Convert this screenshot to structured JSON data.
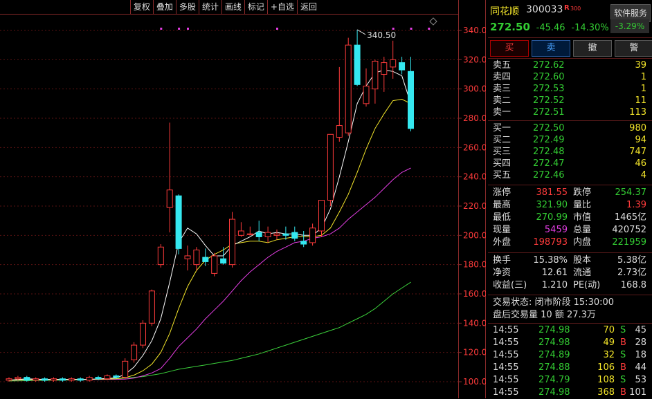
{
  "toolbar": [
    "复权",
    "叠加",
    "多股",
    "统计",
    "画线",
    "标记",
    "+自选",
    "返回"
  ],
  "stock": {
    "name": "同花顺",
    "code": "300033",
    "badge": "R",
    "badge_sub": "300",
    "service": "软件服务",
    "price": "272.50",
    "change": "-45.46",
    "change_pct": "-14.30%",
    "badge_pct": "-3.29%"
  },
  "trade_buttons": [
    "买",
    "卖",
    "撤",
    "警"
  ],
  "sell_orders": [
    {
      "label": "卖五",
      "price": "272.62",
      "vol": "39"
    },
    {
      "label": "卖四",
      "price": "272.60",
      "vol": "1"
    },
    {
      "label": "卖三",
      "price": "272.53",
      "vol": "1"
    },
    {
      "label": "卖二",
      "price": "272.52",
      "vol": "11"
    },
    {
      "label": "卖一",
      "price": "272.51",
      "vol": "113"
    }
  ],
  "buy_orders": [
    {
      "label": "买一",
      "price": "272.50",
      "vol": "980"
    },
    {
      "label": "买二",
      "price": "272.49",
      "vol": "94"
    },
    {
      "label": "买三",
      "price": "272.48",
      "vol": "747"
    },
    {
      "label": "买四",
      "price": "272.47",
      "vol": "46"
    },
    {
      "label": "买五",
      "price": "272.46",
      "vol": "4"
    }
  ],
  "stats": [
    {
      "l1": "涨停",
      "v1": "381.55",
      "c1": "red",
      "l2": "跌停",
      "v2": "254.37",
      "c2": "green"
    },
    {
      "l1": "最高",
      "v1": "321.90",
      "c1": "green",
      "l2": "量比",
      "v2": "1.39",
      "c2": "red"
    },
    {
      "l1": "最低",
      "v1": "270.99",
      "c1": "green",
      "l2": "市值",
      "v2": "1465亿",
      "c2": "white"
    },
    {
      "l1": "现量",
      "v1": "5459",
      "c1": "magenta",
      "l2": "总量",
      "v2": "420752",
      "c2": "white"
    },
    {
      "l1": "外盘",
      "v1": "198793",
      "c1": "red",
      "l2": "内盘",
      "v2": "221959",
      "c2": "green"
    }
  ],
  "stats2": [
    {
      "l1": "换手",
      "v1": "15.38%",
      "c1": "white",
      "l2": "股本",
      "v2": "5.38亿",
      "c2": "white"
    },
    {
      "l1": "净资",
      "v1": "12.61",
      "c1": "white",
      "l2": "流通",
      "v2": "2.73亿",
      "c2": "white"
    },
    {
      "l1": "收益(三)",
      "v1": "1.210",
      "c1": "white",
      "l2": "PE(动)",
      "v2": "168.8",
      "c2": "white"
    }
  ],
  "status": {
    "line1": "交易状态: 闭市阶段 15:30:00",
    "line2": "盘后交易量 10 额 27.3万"
  },
  "ticks": [
    {
      "t": "14:55",
      "p": "274.98",
      "v": "70",
      "bs": "S",
      "n": "45"
    },
    {
      "t": "14:55",
      "p": "274.98",
      "v": "49",
      "bs": "B",
      "n": "28"
    },
    {
      "t": "14:55",
      "p": "274.89",
      "v": "32",
      "bs": "S",
      "n": "18"
    },
    {
      "t": "14:55",
      "p": "274.88",
      "v": "106",
      "bs": "B",
      "n": "44"
    },
    {
      "t": "14:55",
      "p": "274.79",
      "v": "108",
      "bs": "S",
      "n": "53"
    },
    {
      "t": "14:55",
      "p": "274.98",
      "v": "368",
      "bs": "B",
      "n": "101"
    }
  ],
  "colors": {
    "up": "#ff3b3b",
    "down": "#35e8f0",
    "ma5": "#ffffff",
    "ma10": "#f3e52a",
    "ma20": "#e43ee4",
    "ma60": "#3cd23c"
  },
  "chart_data": {
    "type": "candlestick",
    "y_ticks": [
      "340.0",
      "320.0",
      "300.0",
      "280.0",
      "260.0",
      "240.0",
      "220.0",
      "200.0",
      "180.0",
      "160.0",
      "140.0",
      "120.0",
      "100.0"
    ],
    "ylim": [
      98,
      347
    ],
    "max_label": "340.50",
    "candles": [
      {
        "o": 101,
        "c": 102,
        "h": 103,
        "l": 100
      },
      {
        "o": 102,
        "c": 103,
        "h": 104,
        "l": 101
      },
      {
        "o": 103,
        "c": 101,
        "h": 104,
        "l": 100
      },
      {
        "o": 101,
        "c": 102,
        "h": 103,
        "l": 100
      },
      {
        "o": 102,
        "c": 101,
        "h": 103,
        "l": 100
      },
      {
        "o": 101,
        "c": 102,
        "h": 103,
        "l": 100
      },
      {
        "o": 102,
        "c": 101,
        "h": 103,
        "l": 100
      },
      {
        "o": 101,
        "c": 102,
        "h": 103,
        "l": 100
      },
      {
        "o": 102,
        "c": 101,
        "h": 103,
        "l": 100
      },
      {
        "o": 101,
        "c": 103,
        "h": 104,
        "l": 100
      },
      {
        "o": 103,
        "c": 102,
        "h": 104,
        "l": 101
      },
      {
        "o": 102,
        "c": 104,
        "h": 105,
        "l": 101
      },
      {
        "o": 104,
        "c": 103,
        "h": 105,
        "l": 102
      },
      {
        "o": 103,
        "c": 114,
        "h": 116,
        "l": 102
      },
      {
        "o": 115,
        "c": 125,
        "h": 127,
        "l": 113
      },
      {
        "o": 125,
        "c": 140,
        "h": 142,
        "l": 123
      },
      {
        "o": 140,
        "c": 162,
        "h": 163,
        "l": 138
      },
      {
        "o": 180,
        "c": 192,
        "h": 194,
        "l": 178
      },
      {
        "o": 219,
        "c": 231,
        "h": 277,
        "l": 202
      },
      {
        "o": 227,
        "c": 191,
        "h": 228,
        "l": 187
      },
      {
        "o": 184,
        "c": 186,
        "h": 193,
        "l": 176
      },
      {
        "o": 180,
        "c": 190,
        "h": 192,
        "l": 176
      },
      {
        "o": 185,
        "c": 182,
        "h": 191,
        "l": 179
      },
      {
        "o": 174,
        "c": 186,
        "h": 188,
        "l": 172
      },
      {
        "o": 184,
        "c": 181,
        "h": 192,
        "l": 180
      },
      {
        "o": 180,
        "c": 211,
        "h": 216,
        "l": 178
      },
      {
        "o": 200,
        "c": 203,
        "h": 209,
        "l": 199
      },
      {
        "o": 201,
        "c": 201,
        "h": 206,
        "l": 200
      },
      {
        "o": 202,
        "c": 199,
        "h": 210,
        "l": 196
      },
      {
        "o": 199,
        "c": 202,
        "h": 206,
        "l": 195
      },
      {
        "o": 200,
        "c": 201,
        "h": 204,
        "l": 197
      },
      {
        "o": 201,
        "c": 200,
        "h": 206,
        "l": 197
      },
      {
        "o": 202,
        "c": 198,
        "h": 206,
        "l": 196
      },
      {
        "o": 196,
        "c": 194,
        "h": 203,
        "l": 192
      },
      {
        "o": 195,
        "c": 205,
        "h": 208,
        "l": 193
      },
      {
        "o": 203,
        "c": 224,
        "h": 224,
        "l": 199
      },
      {
        "o": 224,
        "c": 269,
        "h": 269,
        "l": 220
      },
      {
        "o": 267,
        "c": 275,
        "h": 315,
        "l": 264
      },
      {
        "o": 270,
        "c": 330,
        "h": 335,
        "l": 268
      },
      {
        "o": 330,
        "c": 303,
        "h": 340.5,
        "l": 302
      },
      {
        "o": 290,
        "c": 302,
        "h": 314,
        "l": 288
      },
      {
        "o": 300,
        "c": 319,
        "h": 320,
        "l": 290
      },
      {
        "o": 310,
        "c": 318,
        "h": 322,
        "l": 298
      },
      {
        "o": 315,
        "c": 320,
        "h": 333,
        "l": 307
      },
      {
        "o": 318,
        "c": 313,
        "h": 322,
        "l": 310
      },
      {
        "o": 312,
        "c": 273,
        "h": 322,
        "l": 271
      }
    ],
    "ma5": [
      101,
      101.5,
      102,
      101.8,
      101.6,
      101.5,
      101.6,
      101.6,
      101.5,
      101.7,
      101.9,
      102.2,
      102.6,
      105,
      110,
      118,
      128,
      143,
      168,
      195,
      205,
      201,
      193,
      186,
      186,
      193,
      196,
      199,
      203,
      201,
      202,
      201,
      201,
      200,
      200,
      205,
      218,
      240,
      264,
      290,
      302,
      311,
      313,
      312,
      309,
      290
    ],
    "ma10": [
      101,
      101.2,
      101.4,
      101.5,
      101.5,
      101.5,
      101.6,
      101.6,
      101.6,
      101.6,
      101.7,
      101.8,
      102,
      102.8,
      104.5,
      107.5,
      112,
      120,
      133,
      150,
      165,
      176,
      183,
      187,
      190,
      194,
      195,
      196,
      196,
      195,
      197,
      198,
      199,
      199,
      199,
      200,
      205,
      216,
      228,
      243,
      259,
      273,
      283,
      292,
      293,
      290
    ],
    "ma20": [
      101,
      101.1,
      101.2,
      101.3,
      101.3,
      101.4,
      101.4,
      101.5,
      101.5,
      101.5,
      101.5,
      101.6,
      101.6,
      101.8,
      102.5,
      104,
      106,
      109,
      116,
      124,
      130,
      136,
      143,
      149,
      155,
      162,
      169,
      175,
      180,
      185,
      189,
      192,
      195,
      196,
      198,
      199,
      201,
      205,
      211,
      216,
      221,
      226,
      232,
      238,
      243,
      246
    ],
    "ma60": [
      100.5,
      100.6,
      100.7,
      100.8,
      100.9,
      101,
      101.1,
      101.2,
      101.3,
      101.5,
      101.7,
      101.9,
      102.1,
      102.5,
      103,
      103.5,
      104.5,
      105.5,
      107,
      108.5,
      109.5,
      110.5,
      111.5,
      112.5,
      113.5,
      114.5,
      116,
      117.5,
      119,
      121,
      123,
      125,
      127,
      129,
      131,
      133,
      135,
      137,
      140,
      143,
      146,
      150,
      155,
      160,
      164,
      168
    ]
  }
}
